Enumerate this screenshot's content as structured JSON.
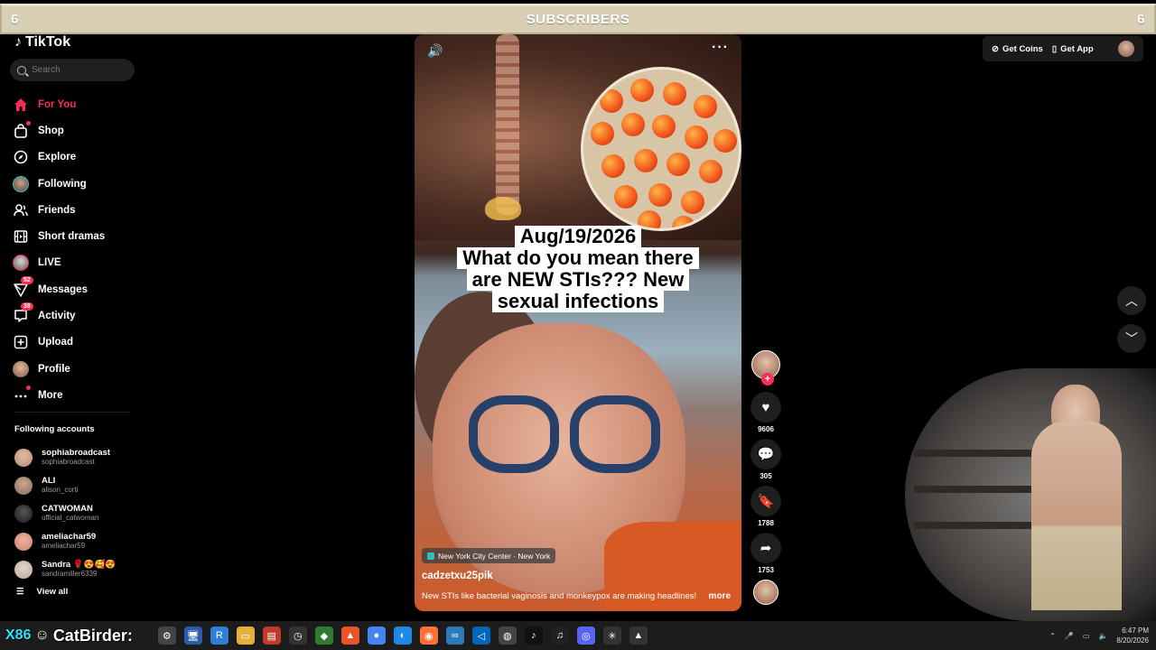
{
  "banner": {
    "left_count": "6",
    "title": "SUBSCRIBERS",
    "right_count": "6"
  },
  "sidebar": {
    "logo_text": "TikTok",
    "search_placeholder": "Search",
    "nav": [
      {
        "label": "For You",
        "icon": "home-icon",
        "active": true
      },
      {
        "label": "Shop",
        "icon": "shopping-bag-icon"
      },
      {
        "label": "Explore",
        "icon": "compass-icon"
      },
      {
        "label": "Following",
        "icon": "following-avatar"
      },
      {
        "label": "Friends",
        "icon": "friends-icon"
      },
      {
        "label": "Short dramas",
        "icon": "film-icon"
      },
      {
        "label": "LIVE",
        "icon": "live-avatar"
      },
      {
        "label": "Messages",
        "icon": "paper-plane-icon",
        "badge": "52"
      },
      {
        "label": "Activity",
        "icon": "activity-icon",
        "badge": "38"
      },
      {
        "label": "Upload",
        "icon": "upload-icon"
      },
      {
        "label": "Profile",
        "icon": "profile-avatar"
      },
      {
        "label": "More",
        "icon": "more-icon"
      }
    ],
    "following_title": "Following accounts",
    "accounts": [
      {
        "name": "sophiabroadcast",
        "handle": "sophiabroadcast",
        "color": "#b58b72"
      },
      {
        "name": "ALI",
        "handle": "alison_corti",
        "color": "#8a6a58"
      },
      {
        "name": "CATWOMAN",
        "handle": "official_catwoman",
        "color": "#2a2a2a"
      },
      {
        "name": "ameliachar59",
        "handle": "ameliachar59",
        "color": "#c9826b"
      },
      {
        "name": "Sandra 🌹😍🥰😍",
        "handle": "sandramiller6339",
        "color": "#b7a79a"
      }
    ],
    "view_all": "View all"
  },
  "video": {
    "caption_lines": [
      "Aug/19/2026",
      "What do you mean there",
      "are NEW STIs??? New",
      "sexual infections"
    ],
    "location": "New York City Center · New York",
    "author": "cadzetxu25pik",
    "description": "New STIs like bacterial vaginosis and monkeypox are making headlines!",
    "more": "more"
  },
  "actions": {
    "likes": "9606",
    "comments": "305",
    "saves": "1788",
    "shares": "1753"
  },
  "topright": {
    "coins": "Get Coins",
    "app": "Get App"
  },
  "taskbar": {
    "logo": "X86",
    "username": "CatBirder:",
    "time": "6:47 PM",
    "date": "8/20/2026"
  }
}
